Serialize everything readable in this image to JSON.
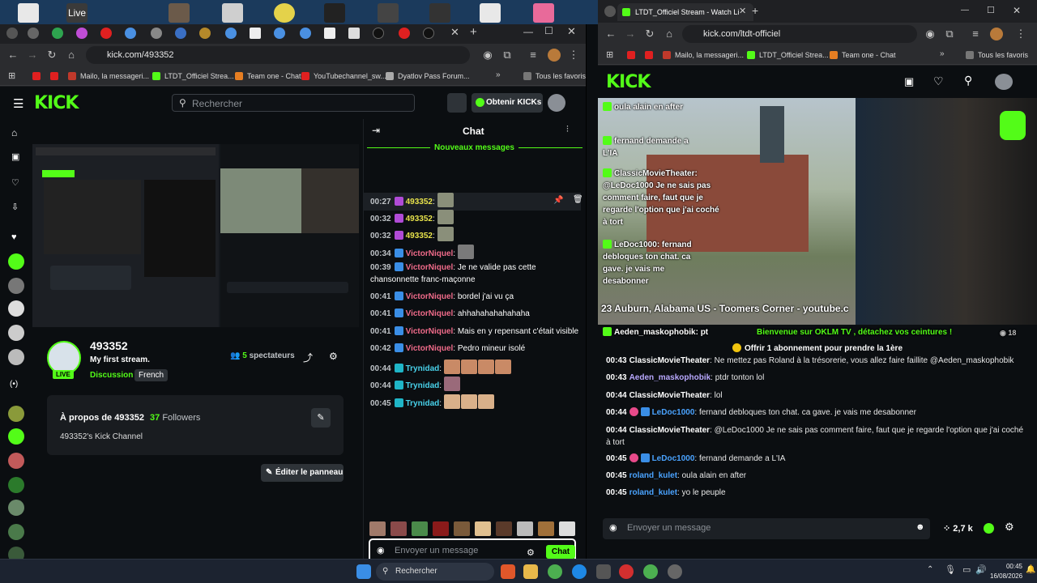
{
  "desktop": {
    "live_label": "Live"
  },
  "left_browser": {
    "url": "kick.com/493352",
    "bookmarks": [
      "Mailo, la messageri...",
      "LTDT_Officiel Strea...",
      "Team one - Chat",
      "YouTubechannel_sw...",
      "Dyatlov Pass Forum...",
      "Tous les favoris"
    ],
    "header": {
      "logo": "KICK",
      "search_placeholder": "Rechercher",
      "obtain_button": "Obtenir KICKs"
    },
    "stream": {
      "live_badge": "LIVE",
      "channel": "493352",
      "title": "My first stream.",
      "tags": [
        "Discussion",
        "French"
      ],
      "viewers_count": "5",
      "viewers_label": "spectateurs"
    },
    "about": {
      "title": "À propos de 493352",
      "followers_count": "37",
      "followers_label": "Followers",
      "description": "493352's Kick Channel",
      "edit_panel_button": "Éditer le panneau"
    },
    "chat": {
      "title": "Chat",
      "new_messages": "Nouveaux messages",
      "messages": [
        {
          "time": "00:27",
          "user": "493352",
          "text": ":",
          "color": "#e7e24b"
        },
        {
          "time": "00:32",
          "user": "493352",
          "text": ":",
          "color": "#e7e24b"
        },
        {
          "time": "00:32",
          "user": "493352",
          "text": ":",
          "color": "#e7e24b"
        },
        {
          "time": "00:34",
          "user": "VictorNiquel",
          "text": ":",
          "color": "#f06b8a"
        },
        {
          "time": "00:39",
          "user": "VictorNiquel",
          "text": ": Je ne valide pas cette",
          "color": "#f06b8a"
        },
        {
          "time": "",
          "user": "",
          "text": "chansonnette franc-maçonne",
          "color": "#fff"
        },
        {
          "time": "00:41",
          "user": "VictorNiquel",
          "text": ": bordel j'ai vu ça",
          "color": "#f06b8a"
        },
        {
          "time": "00:41",
          "user": "VictorNiquel",
          "text": ": ahhahahahahahaha",
          "color": "#f06b8a"
        },
        {
          "time": "00:41",
          "user": "VictorNiquel",
          "text": ": Mais en y repensant c'était visible",
          "color": "#f06b8a"
        },
        {
          "time": "00:42",
          "user": "VictorNiquel",
          "text": ": Pedro mineur isolé",
          "color": "#f06b8a"
        },
        {
          "time": "00:44",
          "user": "Trynidad",
          "text": ":",
          "color": "#48d1ea"
        },
        {
          "time": "00:44",
          "user": "Trynidad",
          "text": ":",
          "color": "#48d1ea"
        },
        {
          "time": "00:45",
          "user": "Trynidad",
          "text": ":",
          "color": "#48d1ea"
        }
      ],
      "input_placeholder": "Envoyer un message",
      "send_button": "Chat"
    }
  },
  "right_browser": {
    "tab_title": "LTDT_Officiel Stream - Watch Li",
    "url": "kick.com/ltdt-officiel",
    "bookmarks": [
      "Mailo, la messageri...",
      "LTDT_Officiel Strea...",
      "Team one - Chat",
      "Tous les favoris"
    ],
    "logo": "KICK",
    "overlay_chat": [
      {
        "user": "",
        "text": "oula alain en after"
      },
      {
        "user": "",
        "text": "fernand demande a L'IA"
      },
      {
        "user": "ClassicMovieTheater",
        "text": ": @LeDoc1000 Je ne sais pas comment faire, faut que je regarde l'option que j'ai coché à tort"
      },
      {
        "user": "LeDoc1000",
        "text": ": fernand debloques ton chat. ca gave. je vais me desabonner"
      },
      {
        "user": "Aeden_maskophobik",
        "text": ": pt"
      }
    ],
    "overlay_location": "23 Auburn, Alabama US - Toomers Corner - youtube.c",
    "overlay_ticker": "Bienvenue sur OKLM TV , détachez vos ceintures !",
    "viewer_small": "18",
    "sub_offer": "Offrir 1 abonnement pour prendre la 1ère",
    "chat": [
      {
        "time": "00:43",
        "user": "ClassicMovieTheater",
        "text": ": Ne mettez pas Roland à la trésorerie, vous allez faire faillite @Aeden_maskophobik",
        "color": "#ffffff"
      },
      {
        "time": "00:43",
        "user": "Aeden_maskophobik",
        "text": ": ptdr tonton lol",
        "color": "#b9a9ff"
      },
      {
        "time": "00:44",
        "user": "ClassicMovieTheater",
        "text": ": lol",
        "color": "#ffffff"
      },
      {
        "time": "00:44",
        "user": "LeDoc1000",
        "text": ": fernand debloques ton chat. ca gave. je vais me desabonner",
        "color": "#4aa3ff"
      },
      {
        "time": "00:44",
        "user": "ClassicMovieTheater",
        "text": ": @LeDoc1000 Je ne sais pas comment faire, faut que je regarde l'option que j'ai coché à tort",
        "color": "#ffffff"
      },
      {
        "time": "00:45",
        "user": "LeDoc1000",
        "text": ": fernand demande a L'IA",
        "color": "#4aa3ff"
      },
      {
        "time": "00:45",
        "user": "roland_kulet",
        "text": ": oula alain en after",
        "color": "#4aa3ff"
      },
      {
        "time": "00:45",
        "user": "roland_kulet",
        "text": ": yo le peuple",
        "color": "#4aa3ff"
      }
    ],
    "input_placeholder": "Envoyer un message",
    "viewers": "2,7 k"
  },
  "taskbar": {
    "search_label": "Rechercher",
    "time": "00:45",
    "date": "16/08/2026"
  }
}
